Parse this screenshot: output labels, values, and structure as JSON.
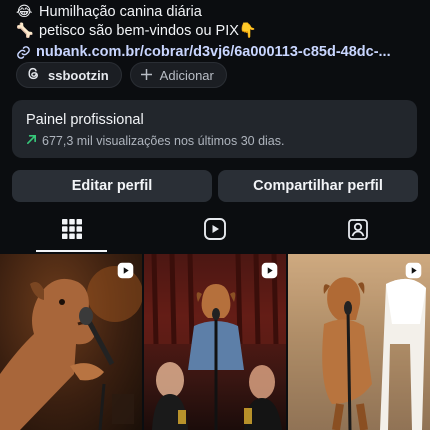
{
  "bio": {
    "line1_emoji": "😂",
    "line1_text": "Humilhação canina diária",
    "line2_emoji": "🦴",
    "line2_text": "petisco são bem-vindos ou PIX👇",
    "link": "nubank.com.br/cobrar/d3vj6/6a000113-c85d-48dc-..."
  },
  "chips": {
    "threads_label": "ssbootzin",
    "add_label": "Adicionar"
  },
  "panel": {
    "title": "Painel profissional",
    "stats": "677,3 mil visualizações nos últimos 30 dias."
  },
  "buttons": {
    "edit": "Editar perfil",
    "share": "Compartilhar perfil"
  },
  "tabs": [
    {
      "name": "grid-icon",
      "active": true
    },
    {
      "name": "reels-icon",
      "active": false
    },
    {
      "name": "tagged-icon",
      "active": false
    }
  ],
  "grid": [
    {
      "type": "reel",
      "subject": "dog singing into microphone in bar"
    },
    {
      "type": "reel",
      "subject": "dog in denim jacket at microphone on stage"
    },
    {
      "type": "reel",
      "subject": "dog standing at microphone next to plastic chair"
    }
  ],
  "colors": {
    "background": "#0b0d10",
    "panel": "#22262c",
    "button": "#2a2f36",
    "growth": "#37c87a",
    "link": "#c9d6ff"
  }
}
